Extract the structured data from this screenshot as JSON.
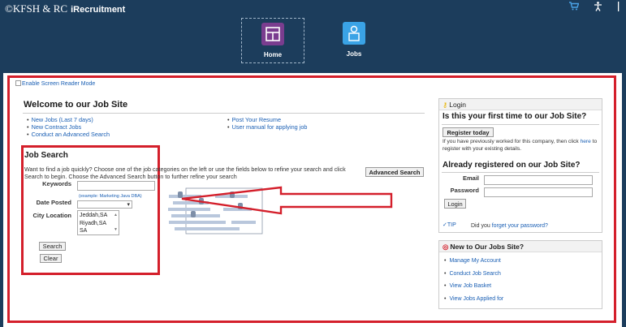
{
  "header": {
    "brand": "©KFSH & RC",
    "app_name": "iRecruitment",
    "icons": [
      "cart-icon",
      "accessibility-icon",
      "more-icon"
    ]
  },
  "nav": {
    "home_label": "Home",
    "jobs_label": "Jobs"
  },
  "screen_reader_link": "Enable Screen Reader Mode",
  "welcome": {
    "title": "Welcome to our Job Site",
    "links_left": [
      "New Jobs (Last 7 days)",
      "New Contract Jobs",
      "Conduct an Advanced Search"
    ],
    "links_right": [
      "Post Your Resume",
      "User manual for applying job"
    ]
  },
  "job_search": {
    "title": "Job Search",
    "description": "Want to find a job quickly? Choose one of the job categories on the left or use the fields below to refine your search and click Search to begin. Choose the Advanced Search button to further refine your search",
    "advanced_button": "Advanced Search",
    "keywords_label": "Keywords",
    "keywords_value": "",
    "keywords_hint": "(example: Marketing Java DBA)",
    "date_posted_label": "Date Posted",
    "date_posted_value": "",
    "city_label": "City Location",
    "cities": [
      "Jeddah,SA",
      "Riyadh,SA",
      "SA"
    ],
    "search_button": "Search",
    "clear_button": "Clear"
  },
  "login": {
    "header": "Login",
    "first_time_title": "Is this your first time to our Job Site?",
    "register_button": "Register today",
    "note_prefix": "If you have previously worked for this company, then click",
    "note_link": "here",
    "note_suffix": "to register with your existing details.",
    "registered_title": "Already registered on our Job Site?",
    "email_label": "Email",
    "email_value": "",
    "password_label": "Password",
    "password_value": "",
    "login_button": "Login",
    "tip_label": "TIP",
    "forgot_prefix": "Did you",
    "forgot_link": "forget your password?"
  },
  "new_to_site": {
    "header": "New to Our Jobs Site?",
    "links": [
      "Manage My Account",
      "Conduct Job Search",
      "View Job Basket",
      "View Jobs Applied for"
    ]
  },
  "colors": {
    "header_bg": "#1c3d5c",
    "highlight_red": "#d41f2b",
    "link_blue": "#1a5fb4",
    "home_tile": "#7a3d8f",
    "jobs_tile": "#3aa3e6"
  }
}
